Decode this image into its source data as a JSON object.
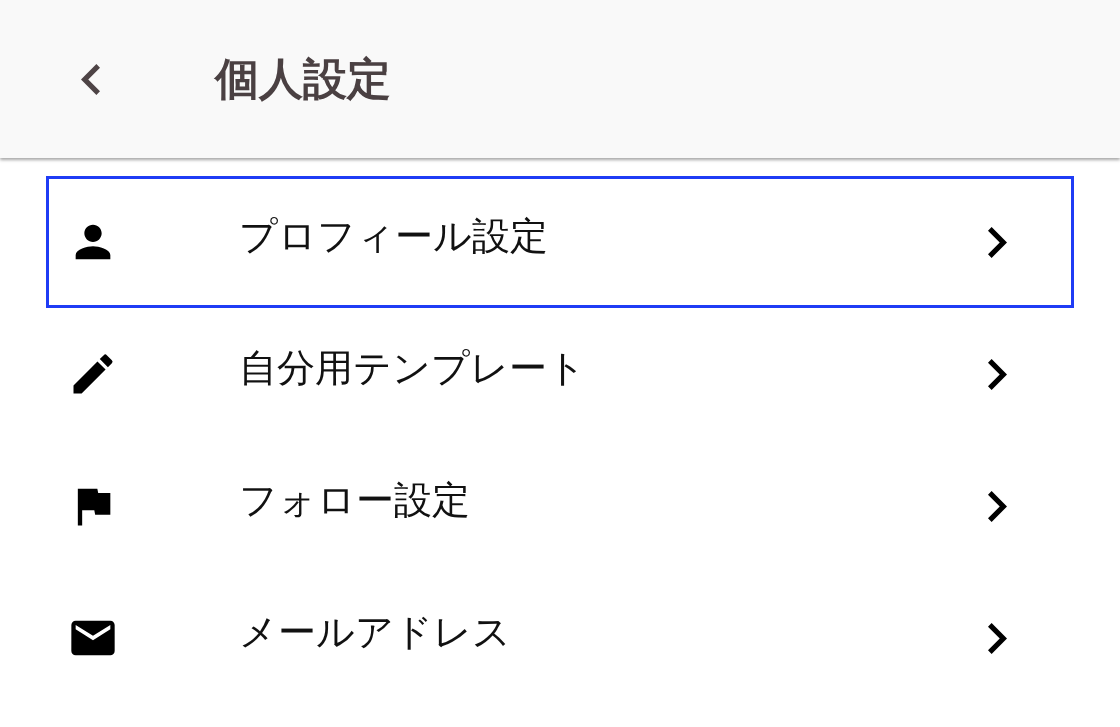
{
  "header": {
    "title": "個人設定"
  },
  "items": [
    {
      "kind": "person",
      "label": "プロフィール設定",
      "selected": true
    },
    {
      "kind": "pencil",
      "label": "自分用テンプレート",
      "selected": false
    },
    {
      "kind": "flag",
      "label": "フォロー設定",
      "selected": false
    },
    {
      "kind": "mail",
      "label": "メールアドレス",
      "selected": false
    }
  ]
}
